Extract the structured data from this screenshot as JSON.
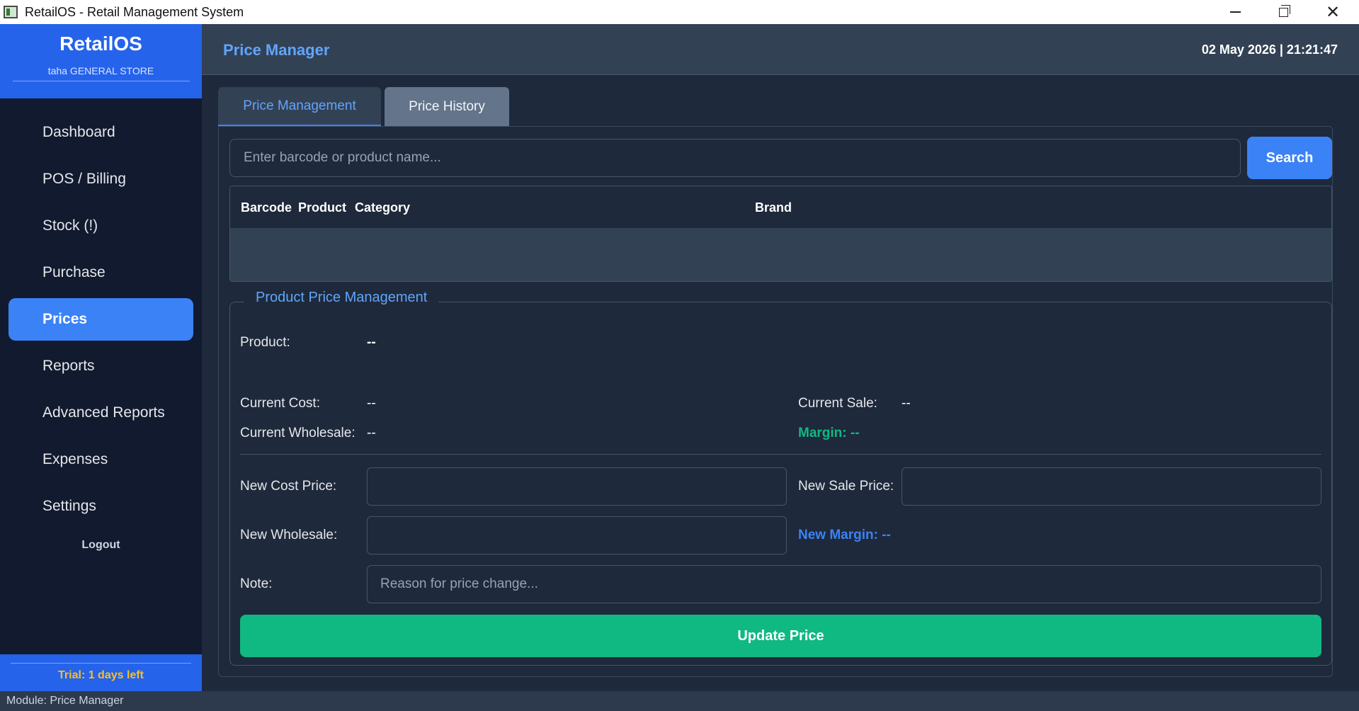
{
  "window": {
    "title": "RetailOS - Retail Management System"
  },
  "sidebar": {
    "brand": "RetailOS",
    "store": "taha GENERAL STORE",
    "items": [
      {
        "label": "Dashboard"
      },
      {
        "label": "POS / Billing"
      },
      {
        "label": "Stock (!)"
      },
      {
        "label": "Purchase"
      },
      {
        "label": "Prices",
        "active": true
      },
      {
        "label": "Reports"
      },
      {
        "label": "Advanced Reports"
      },
      {
        "label": "Expenses"
      },
      {
        "label": "Settings"
      }
    ],
    "logout": "Logout",
    "trial": "Trial: 1 days left"
  },
  "header": {
    "title": "Price Manager",
    "datetime": "02 May 2026  |  21:21:47"
  },
  "tabs": [
    {
      "label": "Price Management",
      "active": true
    },
    {
      "label": "Price History",
      "active": false
    }
  ],
  "search": {
    "placeholder": "Enter barcode or product name...",
    "button": "Search"
  },
  "table": {
    "columns": [
      "Barcode",
      "Product",
      "Category",
      "Brand"
    ],
    "rows": []
  },
  "price_panel": {
    "legend": "Product Price Management",
    "product_label": "Product:",
    "product_value": "--",
    "current_cost_label": "Current Cost:",
    "current_cost_value": "--",
    "current_sale_label": "Current Sale:",
    "current_sale_value": "--",
    "current_wholesale_label": "Current Wholesale:",
    "current_wholesale_value": "--",
    "margin": "Margin: --",
    "new_cost_label": "New Cost Price:",
    "new_sale_label": "New Sale Price:",
    "new_wholesale_label": "New Wholesale:",
    "new_margin": "New Margin: --",
    "note_label": "Note:",
    "note_placeholder": "Reason for price change...",
    "update_button": "Update Price"
  },
  "statusbar": {
    "text": "Module: Price Manager"
  },
  "colors": {
    "accent": "#3b82f6",
    "brand": "#2563eb",
    "success": "#10b981",
    "warning": "#fbbf24",
    "background": "#1e293b",
    "sidebar": "#111a2e"
  }
}
